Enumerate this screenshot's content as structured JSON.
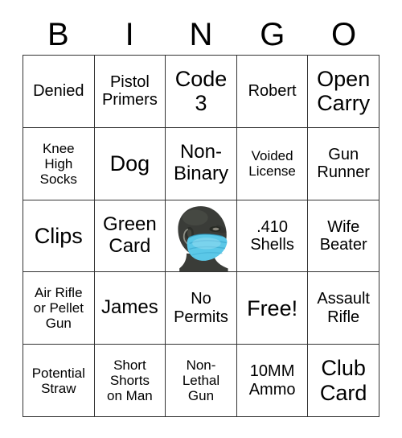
{
  "card": {
    "header_letters": [
      "B",
      "I",
      "N",
      "G",
      "O"
    ],
    "colors": {
      "background": "#ffffff",
      "text": "#000000",
      "grid_line": "#333333",
      "mask_blue": "#5bc8e8",
      "mask_blue_dark": "#3aa6cc",
      "head_dark": "#3a3c38"
    },
    "rows": [
      [
        {
          "text": "Denied",
          "size": "md"
        },
        {
          "text": "Pistol\nPrimers",
          "size": "md"
        },
        {
          "text": "Code\n3",
          "size": "xl"
        },
        {
          "text": "Robert",
          "size": "md"
        },
        {
          "text": "Open\nCarry",
          "size": "xl"
        }
      ],
      [
        {
          "text": "Knee\nHigh\nSocks",
          "size": "sm"
        },
        {
          "text": "Dog",
          "size": "xl"
        },
        {
          "text": "Non-\nBinary",
          "size": "lg"
        },
        {
          "text": "Voided\nLicense",
          "size": "sm"
        },
        {
          "text": "Gun\nRunner",
          "size": "md"
        }
      ],
      [
        {
          "text": "Clips",
          "size": "xl"
        },
        {
          "text": "Green\nCard",
          "size": "lg"
        },
        {
          "type": "image",
          "image": "masked-mannequin-head-photo",
          "alt": "Mannequin head wearing a blue surgical face mask"
        },
        {
          "text": ".410\nShells",
          "size": "md"
        },
        {
          "text": "Wife\nBeater",
          "size": "md"
        }
      ],
      [
        {
          "text": "Air Rifle\nor Pellet\nGun",
          "size": "sm"
        },
        {
          "text": "James",
          "size": "lg"
        },
        {
          "text": "No\nPermits",
          "size": "md"
        },
        {
          "text": "Free!",
          "size": "xl"
        },
        {
          "text": "Assault\nRifle",
          "size": "md"
        }
      ],
      [
        {
          "text": "Potential\nStraw",
          "size": "sm"
        },
        {
          "text": "Short\nShorts\non Man",
          "size": "sm"
        },
        {
          "text": "Non-\nLethal\nGun",
          "size": "sm"
        },
        {
          "text": "10MM\nAmmo",
          "size": "md"
        },
        {
          "text": "Club\nCard",
          "size": "xl"
        }
      ]
    ]
  }
}
